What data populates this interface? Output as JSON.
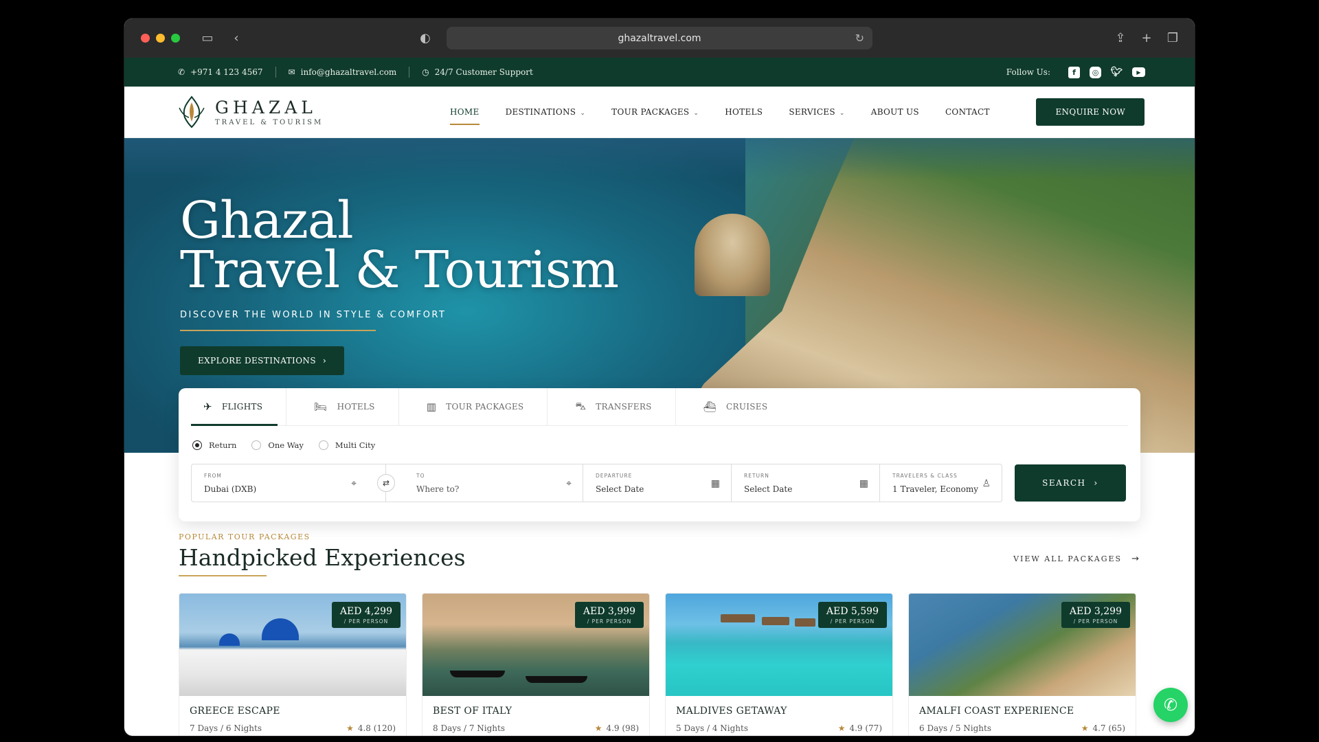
{
  "browser": {
    "url": "ghazaltravel.com",
    "traffic_colors": [
      "#ff5f57",
      "#febc2e",
      "#28c840"
    ]
  },
  "topbar": {
    "phone": "+971 4 123 4567",
    "email": "info@ghazaltravel.com",
    "support": "24/7 Customer Support",
    "follow_label": "Follow Us:",
    "social": [
      "facebook-icon",
      "instagram-icon",
      "twitter-icon",
      "youtube-icon"
    ]
  },
  "brand": {
    "name": "GHAZAL",
    "tagline": "TRAVEL & TOURISM",
    "primary": "#0f3b2c",
    "accent": "#b8893a"
  },
  "nav": {
    "items": [
      {
        "label": "HOME",
        "dropdown": false,
        "active": true
      },
      {
        "label": "DESTINATIONS",
        "dropdown": true,
        "active": false
      },
      {
        "label": "TOUR PACKAGES",
        "dropdown": true,
        "active": false
      },
      {
        "label": "HOTELS",
        "dropdown": false,
        "active": false
      },
      {
        "label": "SERVICES",
        "dropdown": true,
        "active": false
      },
      {
        "label": "ABOUT US",
        "dropdown": false,
        "active": false
      },
      {
        "label": "CONTACT",
        "dropdown": false,
        "active": false
      }
    ],
    "cta": "ENQUIRE NOW"
  },
  "hero": {
    "title_line1": "Ghazal",
    "title_line2": "Travel & Tourism",
    "subtitle": "DISCOVER THE WORLD IN STYLE & COMFORT",
    "button": "EXPLORE DESTINATIONS"
  },
  "booking": {
    "tabs": [
      {
        "label": "FLIGHTS",
        "icon": "plane-icon"
      },
      {
        "label": "HOTELS",
        "icon": "bed-icon"
      },
      {
        "label": "TOUR PACKAGES",
        "icon": "map-icon"
      },
      {
        "label": "TRANSFERS",
        "icon": "car-icon"
      },
      {
        "label": "CRUISES",
        "icon": "ship-icon"
      }
    ],
    "trip_types": [
      "Return",
      "One Way",
      "Multi City"
    ],
    "selected_trip": "Return",
    "from": {
      "label": "FROM",
      "value": "Dubai (DXB)"
    },
    "to": {
      "label": "TO",
      "placeholder": "Where to?"
    },
    "departure": {
      "label": "DEPARTURE",
      "placeholder": "Select Date"
    },
    "return": {
      "label": "RETURN",
      "placeholder": "Select Date"
    },
    "travelers": {
      "label": "TRAVELERS & CLASS",
      "value": "1 Traveler, Economy"
    },
    "search": "SEARCH"
  },
  "packages": {
    "eyebrow": "POPULAR TOUR PACKAGES",
    "title": "Handpicked Experiences",
    "view_all": "VIEW ALL PACKAGES",
    "per_person": "/ PER PERSON",
    "items": [
      {
        "name": "GREECE ESCAPE",
        "duration": "7 Days / 6 Nights",
        "price": "AED 4,299",
        "rating": "4.8 (120)"
      },
      {
        "name": "BEST OF ITALY",
        "duration": "8 Days / 7 Nights",
        "price": "AED 3,999",
        "rating": "4.9 (98)"
      },
      {
        "name": "MALDIVES GETAWAY",
        "duration": "5 Days / 4 Nights",
        "price": "AED 5,599",
        "rating": "4.9 (77)"
      },
      {
        "name": "AMALFI COAST EXPERIENCE",
        "duration": "6 Days / 5 Nights",
        "price": "AED 3,299",
        "rating": "4.7 (65)"
      }
    ]
  }
}
